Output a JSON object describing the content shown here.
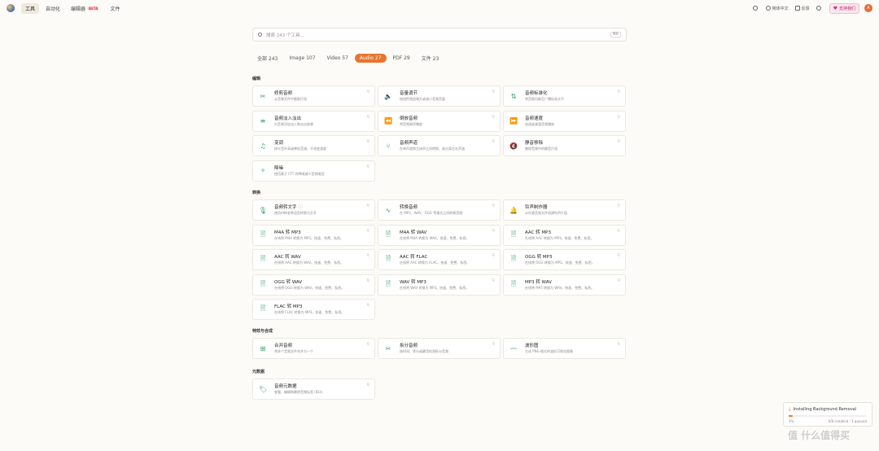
{
  "nav": {
    "items": [
      "工具",
      "自动化",
      "编辑器",
      "文件"
    ],
    "beta": "BETA",
    "lang": "简体中文",
    "feedback": "反馈",
    "support": "支持我们",
    "avatar": "A"
  },
  "search": {
    "placeholder": "搜索 243 个工具...",
    "shortcut": "⌘K"
  },
  "tabs": [
    {
      "label": "全部 243"
    },
    {
      "label": "Image 107"
    },
    {
      "label": "Video 57"
    },
    {
      "label": "Audio 27",
      "active": true
    },
    {
      "label": "PDF 29"
    },
    {
      "label": "文件 23"
    }
  ],
  "sections": [
    {
      "title": "编辑",
      "cards": [
        {
          "title": "修剪音频",
          "desc": "从音频文件中截取片段",
          "icon": "scissors-icon"
        },
        {
          "title": "音量调节",
          "desc": "按线性增益增大或减小音频音量",
          "icon": "volume-icon"
        },
        {
          "title": "音频标准化",
          "desc": "将音量均衡至广播标准水平",
          "icon": "normalize-icon"
        },
        {
          "title": "音频淡入淡出",
          "desc": "为音频添加淡入和淡出效果",
          "icon": "fade-icon"
        },
        {
          "title": "倒放音频",
          "desc": "将音频倒序播放",
          "icon": "rewind-icon"
        },
        {
          "title": "音频速度",
          "desc": "加速或减速音频播放",
          "icon": "fast-forward-icon"
        },
        {
          "title": "变调",
          "desc": "按半音升高或降低音调，不改变速度",
          "icon": "music-note-icon"
        },
        {
          "title": "音频声道",
          "desc": "在单声道和立体声之间转换，或分离左右声道",
          "icon": "split-icon"
        },
        {
          "title": "静音移除",
          "desc": "删除音频中的静音片段",
          "icon": "mute-icon"
        },
        {
          "title": "降噪",
          "desc": "使用基于 FFT 的降噪减少音频噪音",
          "icon": "sparkle-icon"
        }
      ]
    },
    {
      "title": "转换",
      "cards": [
        {
          "title": "音频转文字",
          "desc": "使用AI转录将语音转换为文字",
          "icon": "mic-icon",
          "info": true
        },
        {
          "title": "转换音频",
          "desc": "在 MP3、WAV、OGG 等格式之间转换音频",
          "icon": "wave-icon"
        },
        {
          "title": "铃声制作器",
          "desc": "从任意音频文件创建铃声片段",
          "icon": "bell-icon"
        },
        {
          "title": "M4A 转 MP3",
          "desc": "在线将 M4A 转换为 MP3。快速、免费、私密。",
          "icon": "audio-file-icon"
        },
        {
          "title": "M4A 转 WAV",
          "desc": "在线将 M4A 转换为 WAV。快速、免费、私密。",
          "icon": "audio-file-icon"
        },
        {
          "title": "AAC 转 MP3",
          "desc": "在线将 AAC 转换为 MP3。快速、免费、私密。",
          "icon": "audio-file-icon"
        },
        {
          "title": "AAC 转 WAV",
          "desc": "在线将 AAC 转换为 WAV。快速、免费、私密。",
          "icon": "audio-file-icon"
        },
        {
          "title": "AAC 转 FLAC",
          "desc": "在线将 AAC 转换为 FLAC。快速、免费、私密。",
          "icon": "audio-file-icon"
        },
        {
          "title": "OGG 转 MP3",
          "desc": "在线将 OGG 转换为 MP3。快速、免费、私密。",
          "icon": "audio-file-icon"
        },
        {
          "title": "OGG 转 WAV",
          "desc": "在线将 OGG 转换为 WAV。快速、免费、私密。",
          "icon": "audio-file-icon"
        },
        {
          "title": "WAV 转 MP3",
          "desc": "在线将 WAV 转换为 MP3。快速、免费、私密。",
          "icon": "audio-file-icon"
        },
        {
          "title": "MP3 转 WAV",
          "desc": "在线将 MP3 转换为 WAV。快速、免费、私密。",
          "icon": "audio-file-icon"
        },
        {
          "title": "FLAC 转 MP3",
          "desc": "在线将 FLAC 转换为 MP3。快速、免费、私密。",
          "icon": "audio-file-icon"
        }
      ]
    },
    {
      "title": "特效与合成",
      "cards": [
        {
          "title": "合并音频",
          "desc": "将多个音频文件合并为一个",
          "icon": "merge-icon"
        },
        {
          "title": "拆分音频",
          "desc": "按时间、等分或静音检测拆分音频",
          "icon": "scissors-icon"
        },
        {
          "title": "波形图",
          "desc": "生成 PNG 格式的波形可视化图像",
          "icon": "waveform-icon"
        }
      ]
    },
    {
      "title": "元数据",
      "cards": [
        {
          "title": "音频元数据",
          "desc": "查看、编辑和删除音频标签 (ID3)",
          "icon": "tag-icon"
        }
      ]
    }
  ],
  "toast": {
    "title": "Installing Background Removal",
    "percent_label": "5%",
    "progress": 0.05,
    "status": "0/8 installed · 1 queued"
  },
  "watermark": "值 什么值得买"
}
